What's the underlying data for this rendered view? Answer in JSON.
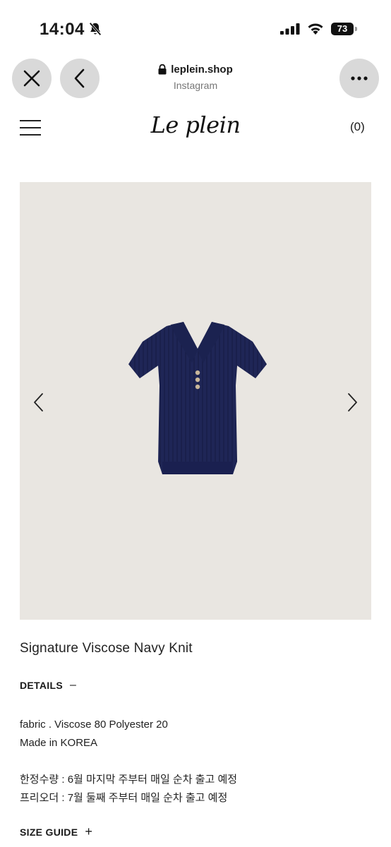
{
  "status_bar": {
    "time": "14:04",
    "battery": "73",
    "icons": [
      "bell-slash-icon",
      "signal-icon",
      "wifi-icon",
      "battery-icon"
    ]
  },
  "browser": {
    "domain": "leplein.shop",
    "source": "Instagram",
    "icons": [
      "close-icon",
      "back-chevron-icon",
      "lock-icon",
      "more-icon"
    ]
  },
  "site": {
    "logo": "Le plein",
    "cart": "(0)",
    "icons": [
      "menu-icon"
    ]
  },
  "product": {
    "image_background": "#e9e6e1",
    "garment_color": "#1f2656",
    "title": "Signature Viscose Navy Knit",
    "details_label": "DETAILS",
    "details_toggle": "–",
    "fabric": "fabric . Viscose 80 Polyester 20",
    "origin": "Made in KOREA",
    "limited_qty": "한정수량 : 6월 마지막 주부터 매일 순차 출고 예정",
    "preorder": "프리오더 : 7월 둘째 주부터 매일 순차 출고 예정",
    "size_guide_label": "SIZE GUIDE",
    "size_guide_toggle": "+",
    "icons": [
      "chevron-left-icon",
      "chevron-right-icon"
    ]
  }
}
